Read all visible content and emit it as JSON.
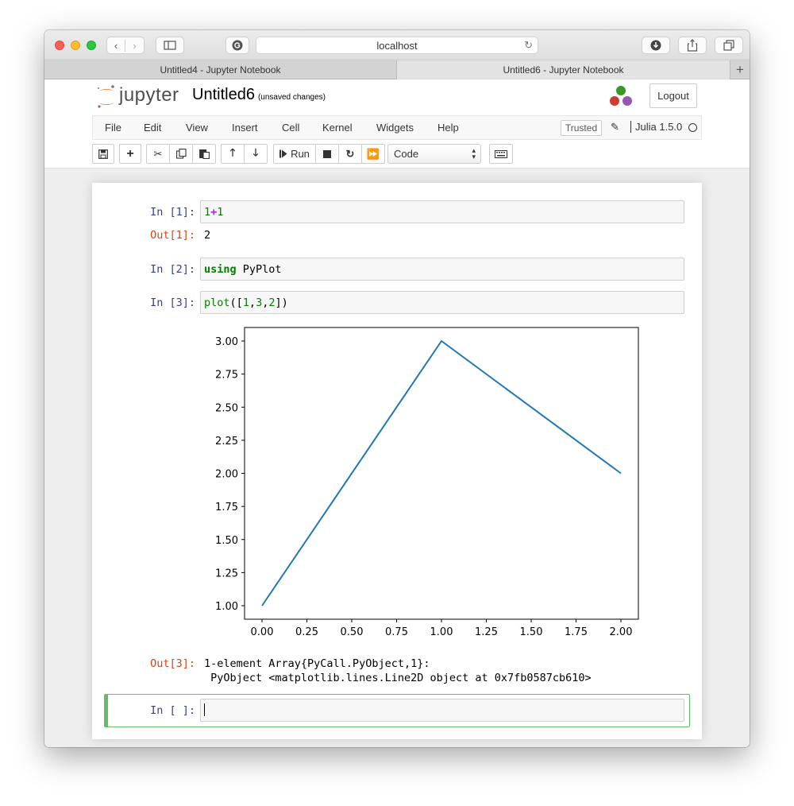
{
  "browser": {
    "address": "localhost",
    "tabs": [
      {
        "label": "Untitled4 - Jupyter Notebook"
      },
      {
        "label": "Untitled6 - Jupyter Notebook"
      }
    ]
  },
  "header": {
    "logo_text": "jupyter",
    "notebook_title": "Untitled6",
    "save_status": "(unsaved changes)",
    "logout_label": "Logout"
  },
  "menu": {
    "items": [
      "File",
      "Edit",
      "View",
      "Insert",
      "Cell",
      "Kernel",
      "Widgets",
      "Help"
    ],
    "trusted_label": "Trusted",
    "kernel_name": "Julia 1.5.0"
  },
  "toolbar": {
    "run_label": "Run",
    "cell_type": "Code"
  },
  "cells": [
    {
      "in_prompt": "In [1]:",
      "out_prompt": "Out[1]:",
      "output": "2"
    },
    {
      "in_prompt": "In [2]:",
      "code_kw": "using",
      "code_rest": " PyPlot"
    },
    {
      "in_prompt": "In [3]:",
      "out_prompt": "Out[3]:",
      "output_line1": "1-element Array{PyCall.PyObject,1}:",
      "output_line2": " PyObject <matplotlib.lines.Line2D object at 0x7fb0587cb610>"
    },
    {
      "in_prompt": "In [ ]:"
    }
  ],
  "chart_data": {
    "type": "line",
    "x": [
      0,
      1,
      2
    ],
    "series": [
      {
        "values": [
          1,
          3,
          2
        ],
        "color": "#1f77b4"
      }
    ],
    "xlim": [
      0,
      2
    ],
    "ylim": [
      1,
      3
    ],
    "xticks": [
      "0.00",
      "0.25",
      "0.50",
      "0.75",
      "1.00",
      "1.25",
      "1.50",
      "1.75",
      "2.00"
    ],
    "yticks": [
      "1.00",
      "1.25",
      "1.50",
      "1.75",
      "2.00",
      "2.25",
      "2.50",
      "2.75",
      "3.00"
    ],
    "grid": false
  }
}
